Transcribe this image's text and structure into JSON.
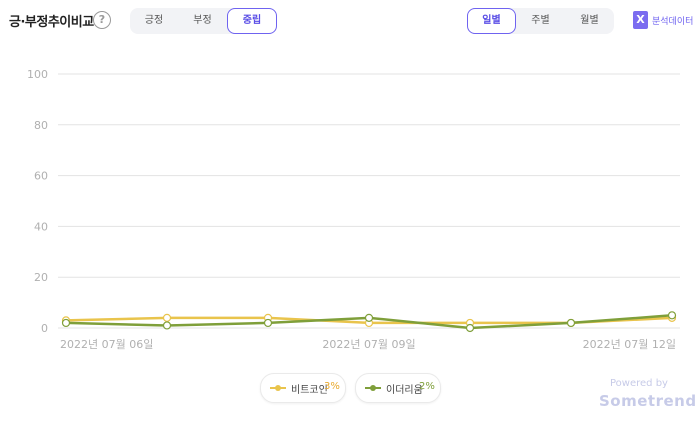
{
  "title": "긍·부정추이비교",
  "help_icon": "?",
  "sentiment_tabs": [
    "긍정",
    "부정",
    "중립"
  ],
  "sentiment_active": 2,
  "period_tabs": [
    "일별",
    "주별",
    "월별"
  ],
  "period_active": 0,
  "export": {
    "icon": "X",
    "label": "분석데이터"
  },
  "colors": {
    "bitcoin": "#e9c44c",
    "ethereum": "#7f9f3a",
    "accent": "#6f63f0"
  },
  "chart_data": {
    "type": "line",
    "x": [
      "2022-07-06",
      "2022-07-07",
      "2022-07-08",
      "2022-07-09",
      "2022-07-10",
      "2022-07-11",
      "2022-07-12"
    ],
    "x_tick_labels": [
      "2022년 07월 06일",
      "2022년 07월 09일",
      "2022년 07월 12일"
    ],
    "ylim": [
      0,
      100
    ],
    "yticks": [
      0,
      20,
      40,
      60,
      80,
      100
    ],
    "grid": true,
    "legend_position": "bottom",
    "series": [
      {
        "name": "비트코인",
        "percent": "3%",
        "values": [
          3,
          4,
          4,
          2,
          2,
          2,
          4
        ]
      },
      {
        "name": "이더리움",
        "percent": "2%",
        "values": [
          2,
          1,
          2,
          4,
          0,
          2,
          5
        ]
      }
    ]
  },
  "footer": {
    "powered": "Powered by",
    "brand": "Sometrend"
  }
}
